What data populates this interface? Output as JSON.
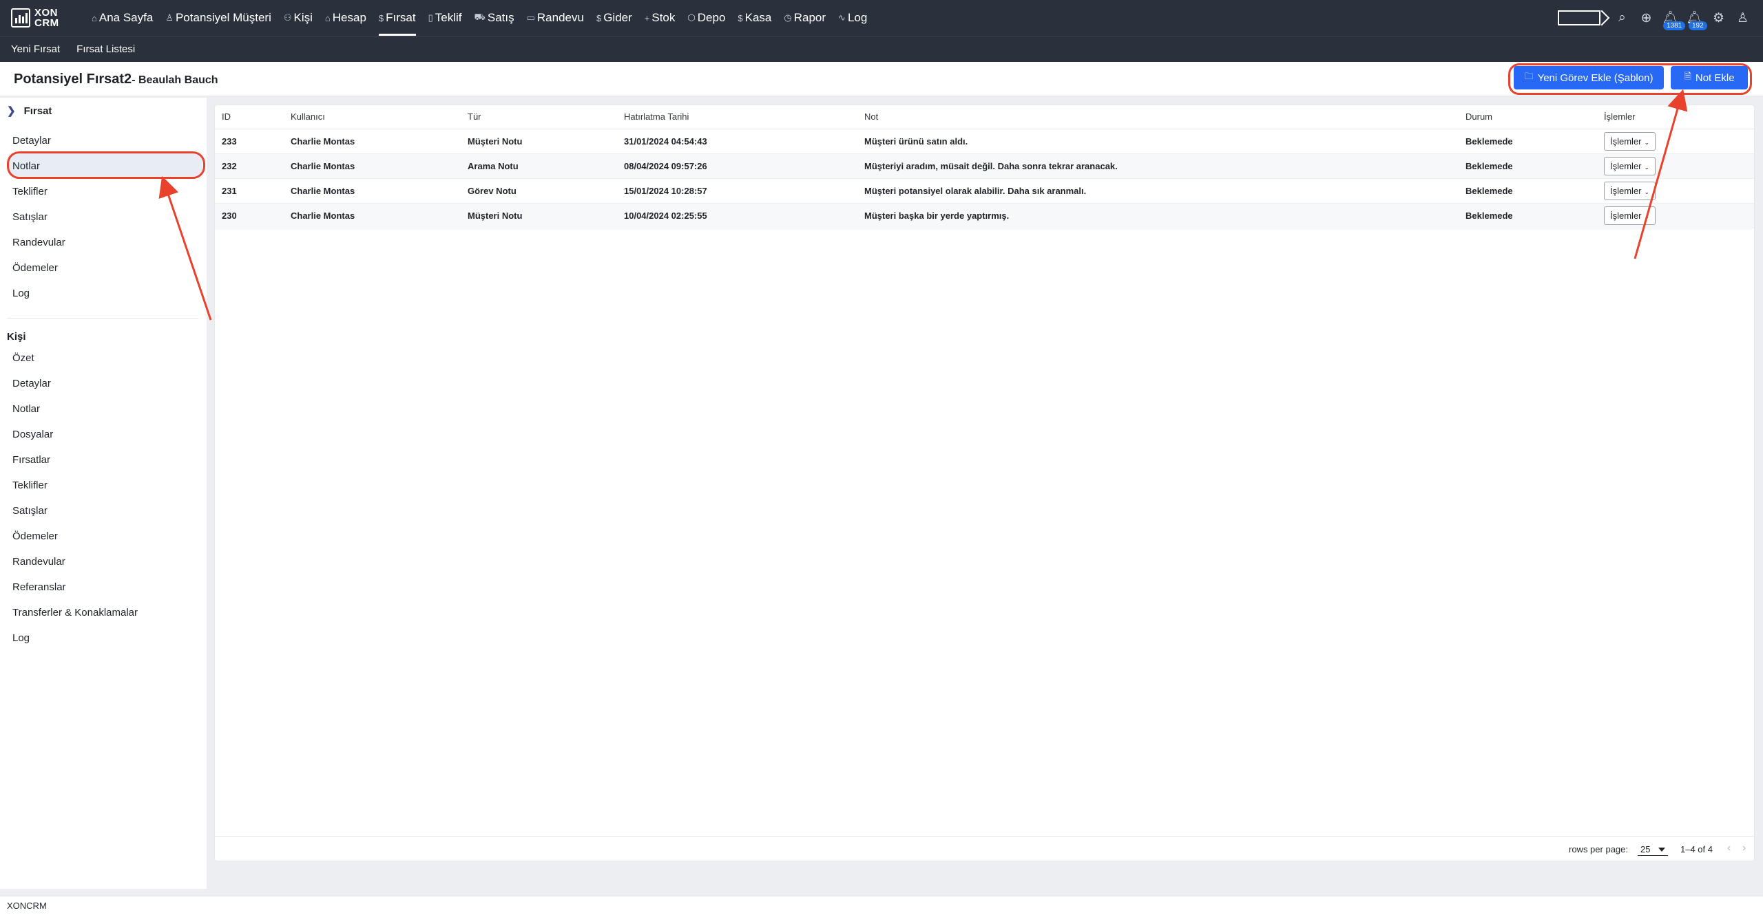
{
  "app": {
    "logo_top": "XON",
    "logo_bottom": "CRM"
  },
  "nav": [
    {
      "label": "Ana Sayfa",
      "icon": "home-icon",
      "glyph": "⌂"
    },
    {
      "label": "Potansiyel Müşteri",
      "icon": "user-icon",
      "glyph": "♙"
    },
    {
      "label": "Kişi",
      "icon": "users-icon",
      "glyph": "⚇"
    },
    {
      "label": "Hesap",
      "icon": "bank-icon",
      "glyph": "⌂"
    },
    {
      "label": "Fırsat",
      "icon": "dollar-icon",
      "glyph": "$"
    },
    {
      "label": "Teklif",
      "icon": "document-icon",
      "glyph": "▯"
    },
    {
      "label": "Satış",
      "icon": "cart-icon",
      "glyph": "⛟"
    },
    {
      "label": "Randevu",
      "icon": "calendar-icon",
      "glyph": "▭"
    },
    {
      "label": "Gider",
      "icon": "dollar-icon",
      "glyph": "$"
    },
    {
      "label": "Stok",
      "icon": "plus-icon",
      "glyph": "+"
    },
    {
      "label": "Depo",
      "icon": "box-icon",
      "glyph": "⬡"
    },
    {
      "label": "Kasa",
      "icon": "dollar-icon",
      "glyph": "$"
    },
    {
      "label": "Rapor",
      "icon": "clock-icon",
      "glyph": "◷"
    },
    {
      "label": "Log",
      "icon": "activity-icon",
      "glyph": "∿"
    }
  ],
  "nav_active_index": 4,
  "notifications": {
    "badge1": "1381",
    "badge2": "192"
  },
  "subnav": {
    "item1": "Yeni Fırsat",
    "item2": "Fırsat Listesi"
  },
  "header": {
    "title": "Potansiyel Fırsat2",
    "subtitle": "- Beaulah Bauch",
    "btn_task": "Yeni Görev Ekle (Şablon)",
    "btn_note": "Not Ekle"
  },
  "sidebar": {
    "section1_title": "Fırsat",
    "section1_items": [
      "Detaylar",
      "Notlar",
      "Teklifler",
      "Satışlar",
      "Randevular",
      "Ödemeler",
      "Log"
    ],
    "section2_title": "Kişi",
    "section2_items": [
      "Özet",
      "Detaylar",
      "Notlar",
      "Dosyalar",
      "Fırsatlar",
      "Teklifler",
      "Satışlar",
      "Ödemeler",
      "Randevular",
      "Referanslar",
      "Transferler & Konaklamalar",
      "Log"
    ]
  },
  "table": {
    "columns": [
      "ID",
      "Kullanıcı",
      "Tür",
      "Hatırlatma Tarihi",
      "Not",
      "Durum",
      "İşlemler"
    ],
    "rows": [
      [
        "233",
        "Charlie Montas",
        "Müşteri Notu",
        "31/01/2024 04:54:43",
        "Müşteri ürünü satın aldı.",
        "Beklemede"
      ],
      [
        "232",
        "Charlie Montas",
        "Arama Notu",
        "08/04/2024 09:57:26",
        "Müşteriyi aradım, müsait değil. Daha sonra tekrar aranacak.",
        "Beklemede"
      ],
      [
        "231",
        "Charlie Montas",
        "Görev Notu",
        "15/01/2024 10:28:57",
        "Müşteri potansiyel olarak alabilir. Daha sık aranmalı.",
        "Beklemede"
      ],
      [
        "230",
        "Charlie Montas",
        "Müşteri Notu",
        "10/04/2024 02:25:55",
        "Müşteri başka bir yerde yaptırmış.",
        "Beklemede"
      ]
    ],
    "action_label": "İşlemler"
  },
  "pagination": {
    "rows_per_page_label": "rows per page:",
    "rows_per_page": "25",
    "range": "1–4 of 4"
  },
  "footer": {
    "text": "XONCRM"
  },
  "colors": {
    "nav_bg": "#2a303c",
    "primary": "#2768f5",
    "annotation": "#e8422c"
  }
}
